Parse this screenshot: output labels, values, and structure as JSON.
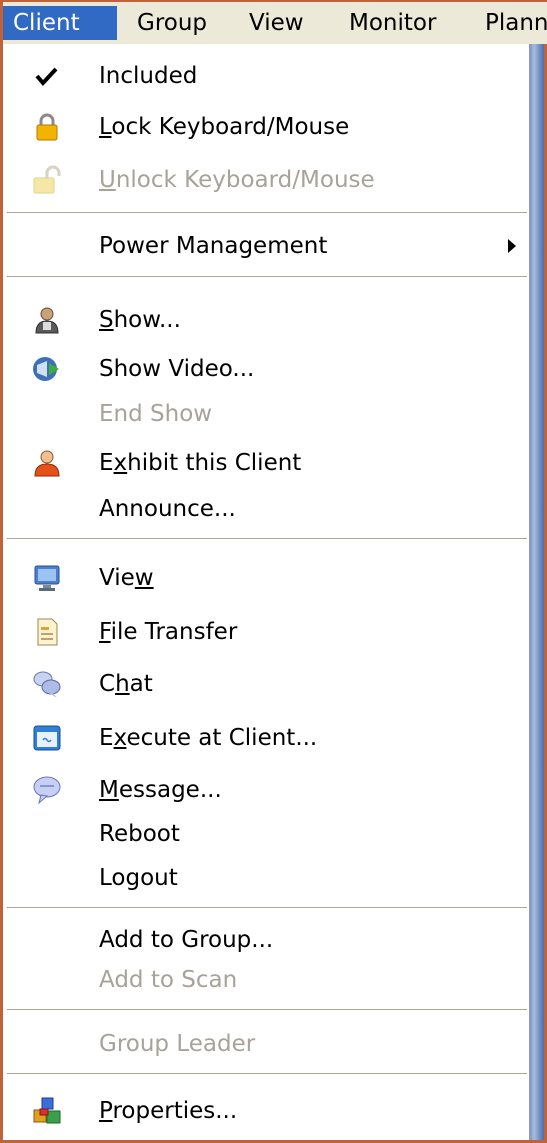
{
  "menubar": {
    "items": [
      {
        "label": "Client"
      },
      {
        "label": "Group"
      },
      {
        "label": "View"
      },
      {
        "label": "Monitor"
      },
      {
        "label": "Plann"
      }
    ]
  },
  "menu": {
    "included": "Included",
    "lock_pre": "",
    "lock_u": "L",
    "lock_post": "ock Keyboard/Mouse",
    "unlock_pre": "",
    "unlock_u": "U",
    "unlock_post": "nlock Keyboard/Mouse",
    "power": "Power Management",
    "show_pre": "",
    "show_u": "S",
    "show_post": "how...",
    "show_video": "Show Video...",
    "end_show": "End Show",
    "exhibit_pre": "E",
    "exhibit_u": "x",
    "exhibit_post": "hibit this Client",
    "announce": "Announce...",
    "view_pre": "Vie",
    "view_u": "w",
    "view_post": "",
    "file_pre": "",
    "file_u": "F",
    "file_post": "ile Transfer",
    "chat_pre": "C",
    "chat_u": "h",
    "chat_post": "at",
    "execute_pre": "E",
    "execute_u": "x",
    "execute_post": "ecute at Client...",
    "message_pre": "",
    "message_u": "M",
    "message_post": "essage...",
    "reboot": "Reboot",
    "logout": "Logout",
    "add_group": "Add to Group...",
    "add_scan": "Add to Scan",
    "group_leader": "Group Leader",
    "properties_pre": "",
    "properties_u": "P",
    "properties_post": "roperties..."
  },
  "icons": {
    "included": "checkmark-icon",
    "lock": "padlock-icon",
    "unlock": "unlocked-padlock-icon",
    "show": "presenter-icon",
    "show_video": "video-icon",
    "exhibit": "user-icon",
    "view": "monitor-icon",
    "file": "document-icon",
    "chat": "chat-bubbles-icon",
    "execute": "window-execute-icon",
    "message": "speech-bubble-icon",
    "properties": "properties-blocks-icon",
    "power_submenu": "submenu-arrow-icon"
  },
  "colors": {
    "menubar_active": "#316ac5",
    "disabled_text": "#a7a39a"
  }
}
